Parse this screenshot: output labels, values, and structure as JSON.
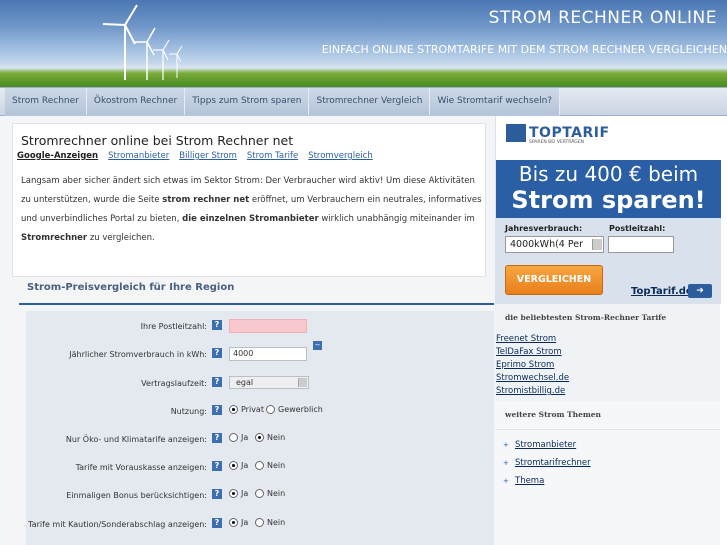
{
  "header": {
    "title": "STROM RECHNER ONLINE",
    "subtitle": "EINFACH ONLINE STROMTARIFE MIT DEM STROM RECHNER VERGLEICHEN"
  },
  "nav": {
    "items": [
      {
        "label": "Strom Rechner"
      },
      {
        "label": "Ökostrom Rechner"
      },
      {
        "label": "Tipps zum Strom sparen"
      },
      {
        "label": "Stromrechner Vergleich"
      },
      {
        "label": "Wie Stromtarif wechseln?"
      }
    ]
  },
  "intro": {
    "heading": "Stromrechner online bei Strom Rechner net",
    "subnav": [
      "Google-Anzeigen",
      "Stromanbieter",
      "Billiger Strom",
      "Strom Tarife",
      "Stromvergleich"
    ],
    "text_1": "Langsam aber sicher ändert sich etwas im Sektor Strom: Der Verbraucher wird aktiv! Um diese Aktivitäten zu unterstützen, wurde die Seite ",
    "text_bold_1": "strom rechner net",
    "text_2": " eröffnet, um Verbrauchern ein neutrales, informatives und unverbindliches Portal zu bieten, ",
    "text_bold_2": "die einzelnen Stromanbieter",
    "text_3": " wirklich unabhängig miteinander im ",
    "text_bold_3": "Stromrechner",
    "text_4": " zu vergleichen."
  },
  "compare": {
    "title": "Strom-Preisvergleich für Ihre Region",
    "help_glyph": "?",
    "collapse_glyph": "−",
    "postleitzahl_label": "Ihre Postleitzahl:",
    "postleitzahl_value": "",
    "verbrauch_label": "Jährlicher Stromverbrauch in kWh:",
    "verbrauch_value": "4000",
    "laufzeit_label": "Vertragslaufzeit:",
    "laufzeit_value": "egal",
    "nutzung_label": "Nutzung:",
    "nutzung_opt1": "Privat",
    "nutzung_opt2": "Gewerblich",
    "oeko_label": "Nur Öko- und Klimatarife anzeigen:",
    "vorauskasse_label": "Tarife mit Vorauskasse anzeigen:",
    "bonus_label": "Einmaligen Bonus berücksichtigen:",
    "kaution_label": "Tarife mit Kaution/Sonderabschlag anzeigen:",
    "ja": "Ja",
    "nein": "Nein"
  },
  "ad": {
    "brand": "TOPTARIF",
    "slogan": "SPAREN BEI VERTRÄGEN",
    "banner_line1": "Bis zu 400 € beim",
    "banner_line2": "Strom sparen!",
    "jahresverbrauch_label": "Jahresverbrauch:",
    "jahresverbrauch_value": "4000kWh(4 Per",
    "plz_label": "Postleitzahl:",
    "button_label": "VERGLEICHEN",
    "link_label": "TopTarif.de",
    "arrow_glyph": "➜"
  },
  "sidebar": {
    "tarife_heading": "die beliebtesten Strom-Rechner Tarife",
    "tarife": [
      "Freenet Strom",
      "TelDaFax Strom",
      "Eprimo Strom",
      "Stromwechsel.de",
      "Stromistbillig.de"
    ],
    "themen_heading": "weitere Strom Themen",
    "themen": [
      "Stromanbieter",
      "Stromtarifrechner",
      "Thema"
    ],
    "bullet": "+"
  }
}
